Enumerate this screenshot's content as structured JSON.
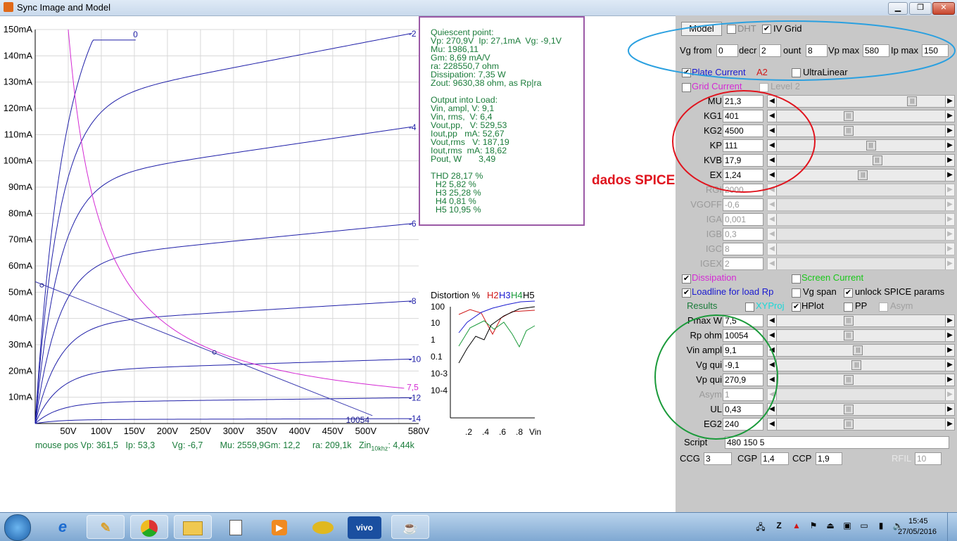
{
  "window": {
    "title": "Sync Image and Model",
    "btn_min": "▁",
    "btn_max": "❐",
    "btn_close": "✕"
  },
  "plot": {
    "y_ticks": [
      "150mA",
      "140mA",
      "130mA",
      "120mA",
      "110mA",
      "100mA",
      "90mA",
      "80mA",
      "70mA",
      "60mA",
      "50mA",
      "40mA",
      "30mA",
      "20mA",
      "10mA"
    ],
    "x_ticks": [
      "50V",
      "100V",
      "150V",
      "200V",
      "250V",
      "300V",
      "350V",
      "400V",
      "450V",
      "500V",
      "580V"
    ],
    "grid_curves": [
      {
        "vg": "0"
      },
      {
        "vg": "-2"
      },
      {
        "vg": "-4"
      },
      {
        "vg": "-6"
      },
      {
        "vg": "-8"
      },
      {
        "vg": "-10"
      },
      {
        "vg": "-12"
      },
      {
        "vg": "-14"
      }
    ],
    "dissipation_label": "7,5",
    "load_label": "10054",
    "colors": {
      "curves": "#1f1fa8",
      "dissipation": "#d42ad4",
      "loadline": "#3a3ab0"
    }
  },
  "info": {
    "lines": [
      "Quiescent point:",
      "Vp: 270,9V  Ip: 27,1mA  Vg: -9,1V",
      "Mu: 1986,11",
      "Gm: 8,69 mA/V",
      "ra: 228550,7 ohm",
      "Dissipation: 7,35 W",
      "Zout: 9630,38 ohm, as Rp|ra",
      "",
      "Output into Load:",
      "Vin, ampl, V: 9,1",
      "Vin, rms,  V: 6,4",
      "Vout,pp,   V: 529,53",
      "Iout,pp   mA: 52,67",
      "Vout,rms   V: 187,19",
      "Iout,rms  mA: 18,62",
      "Pout, W       3,49",
      "",
      "THD 28,17 %",
      "  H2 5,82 %",
      "  H3 25,28 %",
      "  H4 0,81 %",
      "  H5 10,95 %"
    ]
  },
  "distortion": {
    "title": "Distortion %",
    "harmonics": [
      {
        "label": "H2",
        "color": "#d01818"
      },
      {
        "label": "H3",
        "color": "#1a1ad0"
      },
      {
        "label": "H4",
        "color": "#1a9a3a"
      },
      {
        "label": "H5",
        "color": "#000000"
      }
    ],
    "y_ticks": [
      "100",
      "10",
      "1",
      "0.1",
      "10-3",
      "10-4"
    ],
    "x_ticks": [
      ".2",
      ".4",
      ".6",
      ".8"
    ],
    "x_label": "Vin"
  },
  "mouse": {
    "text": "mouse pos Vp: 361,5   Ip: 53,3       Vg: -6,7       Mu: 2559,9Gm: 12,2     ra: 209,1k   Zin",
    "sub": "10khz",
    "tail": ": 4,44k"
  },
  "annotation": {
    "text": "dados SPICE"
  },
  "panel": {
    "model_btn": "Model",
    "dht_label": "DHT",
    "ivgrid_label": "IV Grid",
    "vg_from_label": "Vg from",
    "vg_from": "0",
    "decr_label": "decr",
    "decr": "2",
    "count_label": "ount",
    "count": "8",
    "vpmax_label": "Vp max",
    "vpmax": "580",
    "ipmax_label": "Ip max",
    "ipmax": "150",
    "plate_current": "Plate Current",
    "a2": "A2",
    "ultralinear": "UltraLinear",
    "grid_current": "Grid Current",
    "level2": "Level 2",
    "params": [
      {
        "name": "MU",
        "value": "21,3",
        "pos": 0.82,
        "enabled": true
      },
      {
        "name": "KG1",
        "value": "401",
        "pos": 0.42,
        "enabled": true
      },
      {
        "name": "KG2",
        "value": "4500",
        "pos": 0.42,
        "enabled": true
      },
      {
        "name": "KP",
        "value": "111",
        "pos": 0.56,
        "enabled": true
      },
      {
        "name": "KVB",
        "value": "17,9",
        "pos": 0.6,
        "enabled": true
      },
      {
        "name": "EX",
        "value": "1,24",
        "pos": 0.51,
        "enabled": true
      },
      {
        "name": "RGI",
        "value": "2000",
        "pos": 0,
        "enabled": false
      },
      {
        "name": "VGOFF",
        "value": "-0,6",
        "pos": 0,
        "enabled": false
      },
      {
        "name": "IGA",
        "value": "0,001",
        "pos": 0,
        "enabled": false
      },
      {
        "name": "IGB",
        "value": "0,3",
        "pos": 0,
        "enabled": false
      },
      {
        "name": "IGC",
        "value": "8",
        "pos": 0,
        "enabled": false
      },
      {
        "name": "IGEX",
        "value": "2",
        "pos": 0,
        "enabled": false
      }
    ],
    "dissipation": "Dissipation",
    "screen_current": "Screen Current",
    "loadline": "Loadline for load Rp",
    "vg_span": "Vg span",
    "unlock": "unlock SPICE params",
    "results": "Results",
    "xyproj": "XYProj",
    "hplot": "HPlot",
    "pp": "PP",
    "asym_cb": "Asym",
    "outputs": [
      {
        "name": "Pmax W",
        "value": "7,5",
        "pos": 0.42,
        "enabled": true
      },
      {
        "name": "Rp ohm",
        "value": "10054",
        "pos": 0.42,
        "enabled": true
      },
      {
        "name": "Vin ampl",
        "value": "9,1",
        "pos": 0.48,
        "enabled": true
      },
      {
        "name": "Vg qui",
        "value": "-9,1",
        "pos": 0.47,
        "enabled": true
      },
      {
        "name": "Vp qui",
        "value": "270,9",
        "pos": 0.42,
        "enabled": true
      },
      {
        "name": "Asym",
        "value": "1",
        "pos": 0,
        "enabled": false
      },
      {
        "name": "UL",
        "value": "0,43",
        "pos": 0.42,
        "enabled": true
      },
      {
        "name": "EG2",
        "value": "240",
        "pos": 0.42,
        "enabled": true
      }
    ],
    "script_label": "Script",
    "script": "480 150 5",
    "ccg_label": "CCG",
    "ccg": "3",
    "cgp_label": "CGP",
    "cgp": "1,4",
    "ccp_label": "CCP",
    "ccp": "1,9",
    "rfil_label": "RFIL",
    "rfil": "10"
  },
  "taskbar": {
    "vivo": "vivo",
    "time": "15:45",
    "date": "27/05/2016"
  }
}
